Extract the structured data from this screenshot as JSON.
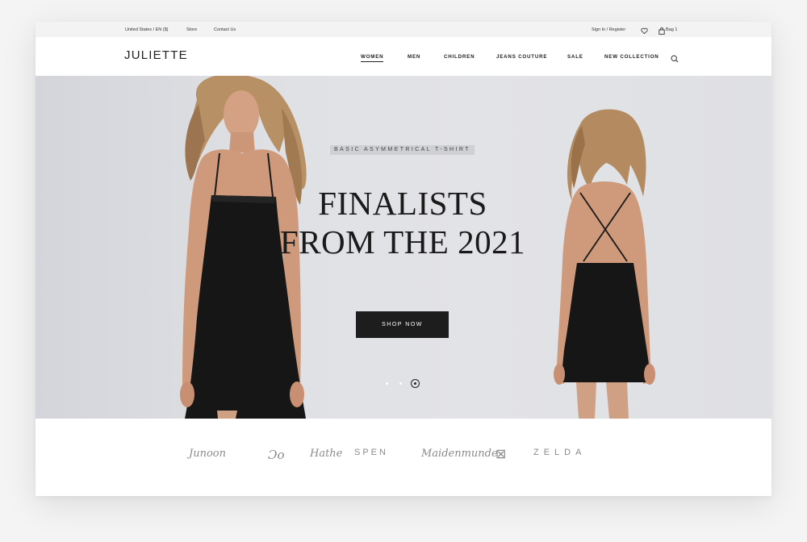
{
  "topbar": {
    "region": "United States / EN ($)",
    "store": "Store",
    "contact": "Contact Us",
    "account": "Sign In / Register",
    "bag": "Bag 1"
  },
  "header": {
    "logo": "JULIETTE",
    "nav": [
      "WOMEN",
      "MEN",
      "CHILDREN",
      "JEANS COUTURE",
      "SALE",
      "NEW COLLECTION"
    ]
  },
  "hero": {
    "tagline": "BASIC ASYMMETRICAL T-SHIRT",
    "headline_line1": "FINALISTS",
    "headline_line2": "FROM THE 2021",
    "cta": "SHOP NOW",
    "slides_total": 3,
    "active_slide": 3
  },
  "brands": [
    "Junoon",
    "Ɔo",
    "Hathe",
    "SPEN",
    "Maidenmunde",
    "⊠",
    "ZELDA"
  ],
  "colors": {
    "accent": "#1d1d1d",
    "hero_bg": "#e0e1e5",
    "topbar_bg": "#f3f3f3"
  }
}
